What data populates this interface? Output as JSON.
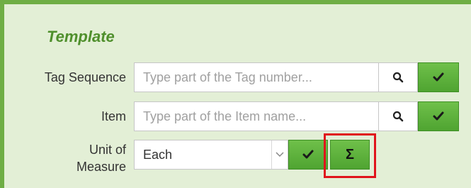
{
  "section_title": "Template",
  "fields": {
    "tag_sequence": {
      "label": "Tag Sequence",
      "placeholder": "Type part of the Tag number..."
    },
    "item": {
      "label": "Item",
      "placeholder": "Type part of the Item name..."
    },
    "unit_of_measure": {
      "label_line1": "Unit of",
      "label_line2": "Measure",
      "selected": "Each",
      "sum_symbol": "Σ"
    }
  },
  "icons": {
    "search": "search-icon",
    "confirm": "checkmark-icon",
    "dropdown": "chevron-down-icon"
  },
  "colors": {
    "panel_bg": "#e3efd6",
    "border_green": "#6fae45",
    "title_green": "#4f8f2c",
    "button_green": "#5cb13a",
    "highlight_red": "#e0141c"
  }
}
